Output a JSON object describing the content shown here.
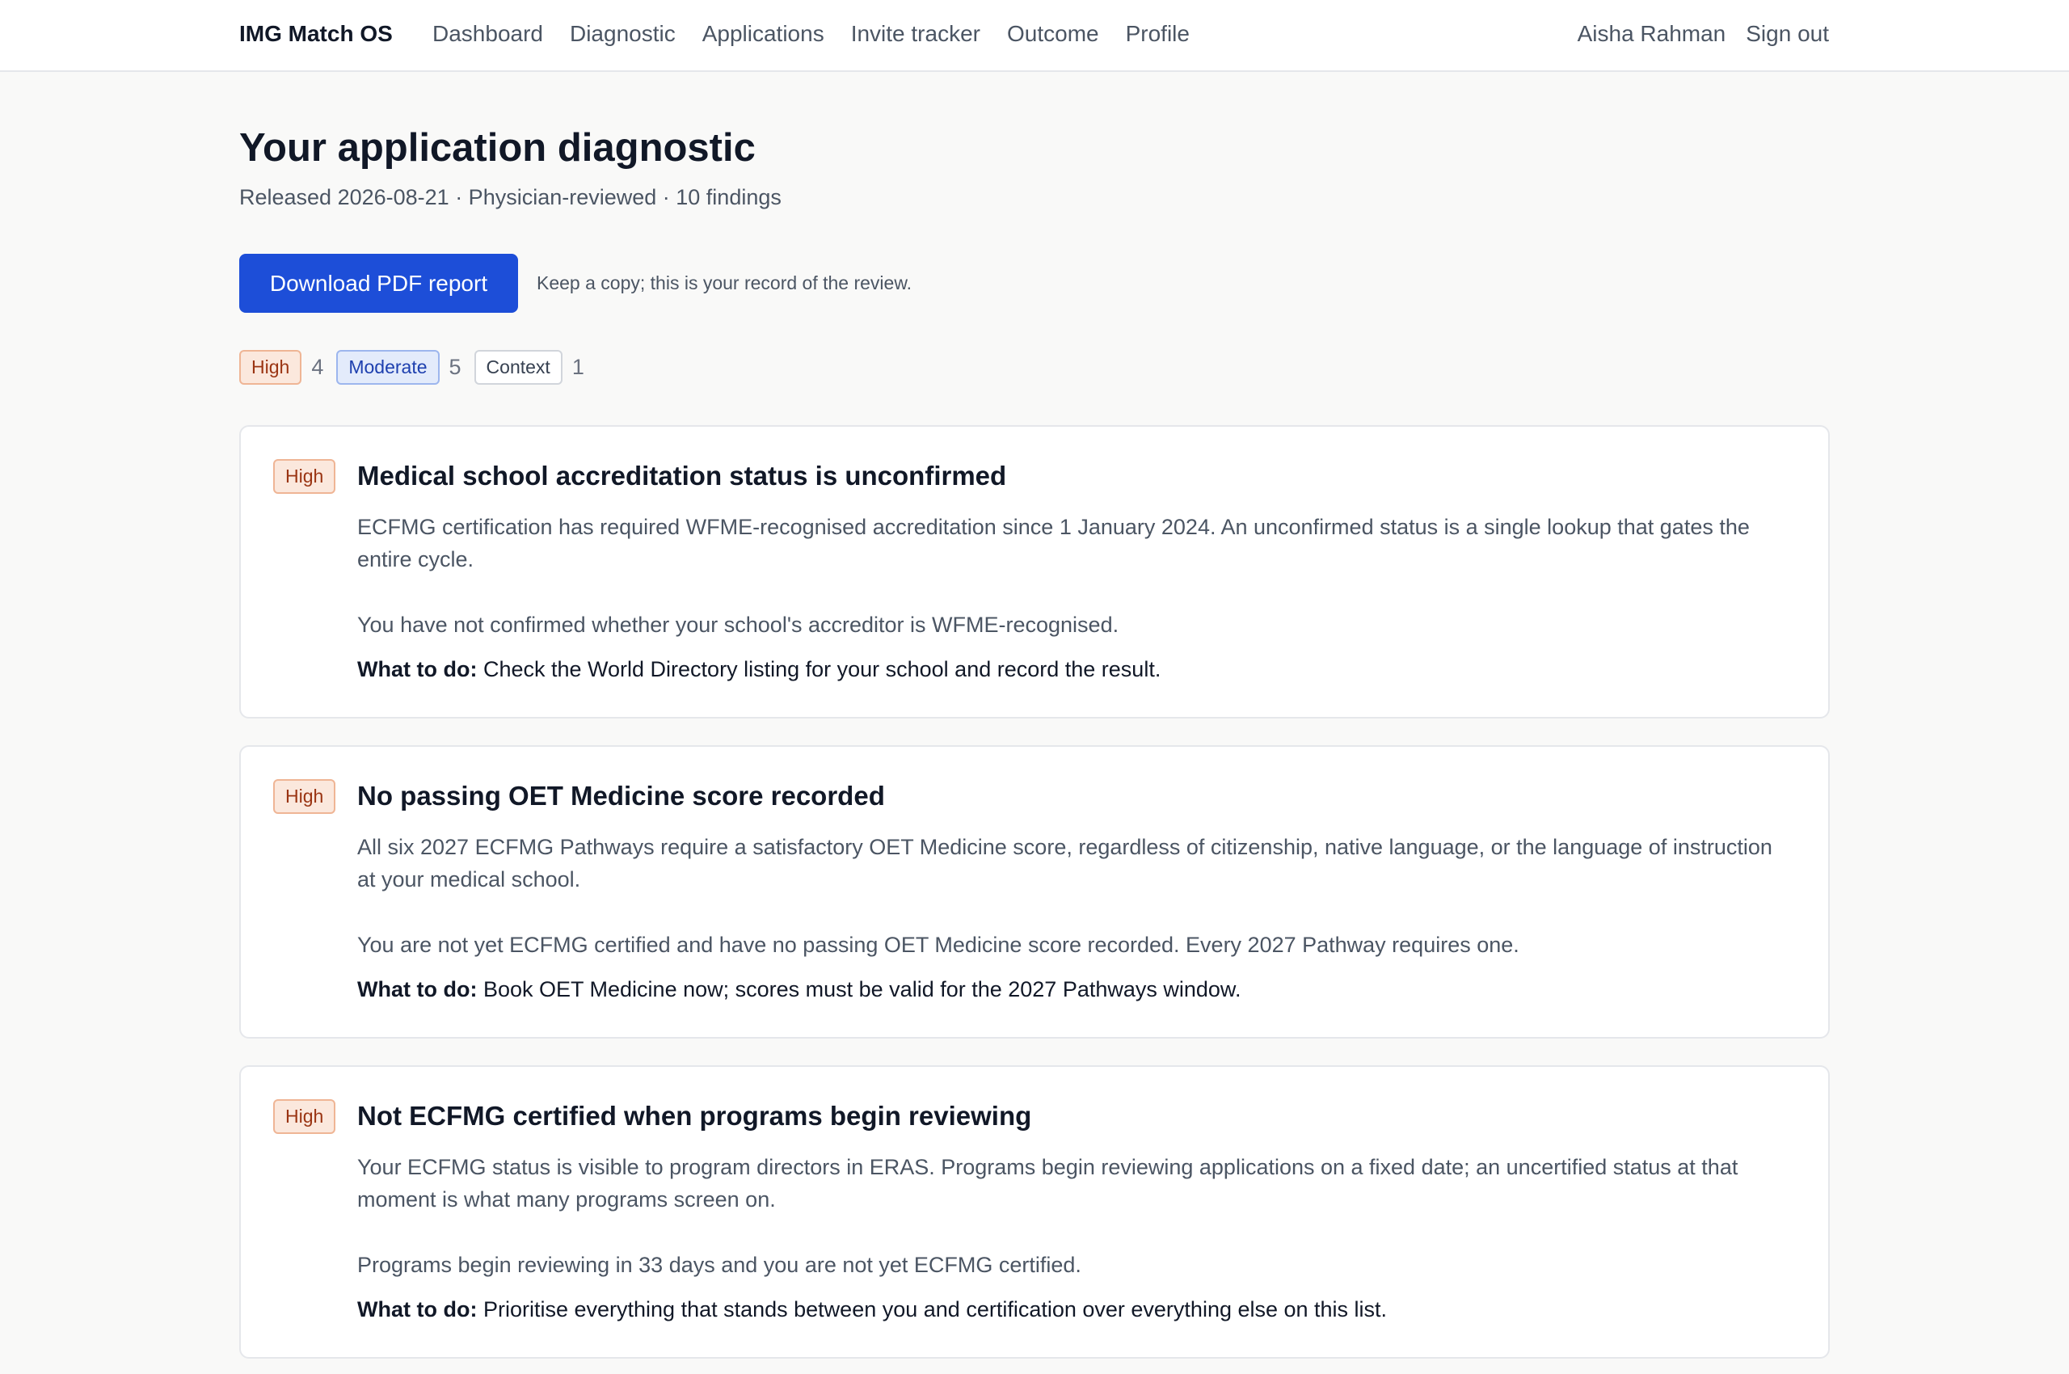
{
  "nav": {
    "brand": "IMG Match OS",
    "links": [
      "Dashboard",
      "Diagnostic",
      "Applications",
      "Invite tracker",
      "Outcome",
      "Profile"
    ],
    "user_name": "Aisha Rahman",
    "sign_out": "Sign out"
  },
  "page": {
    "title": "Your application diagnostic",
    "subtitle": "Released 2026-08-21 · Physician-reviewed · 10 findings",
    "download_label": "Download PDF report",
    "download_note": "Keep a copy; this is your record of the review."
  },
  "summary": {
    "high_label": "High",
    "high_count": "4",
    "moderate_label": "Moderate",
    "moderate_count": "5",
    "context_label": "Context",
    "context_count": "1"
  },
  "findings": [
    {
      "severity": "High",
      "title": "Medical school accreditation status is unconfirmed",
      "description": "ECFMG certification has required WFME-recognised accreditation since 1 January 2024. An unconfirmed status is a single lookup that gates the entire cycle.",
      "detail": "You have not confirmed whether your school's accreditor is WFME-recognised.",
      "action_label": "What to do:",
      "action": "Check the World Directory listing for your school and record the result."
    },
    {
      "severity": "High",
      "title": "No passing OET Medicine score recorded",
      "description": "All six 2027 ECFMG Pathways require a satisfactory OET Medicine score, regardless of citizenship, native language, or the language of instruction at your medical school.",
      "detail": "You are not yet ECFMG certified and have no passing OET Medicine score recorded. Every 2027 Pathway requires one.",
      "action_label": "What to do:",
      "action": "Book OET Medicine now; scores must be valid for the 2027 Pathways window."
    },
    {
      "severity": "High",
      "title": "Not ECFMG certified when programs begin reviewing",
      "description": "Your ECFMG status is visible to program directors in ERAS. Programs begin reviewing applications on a fixed date; an uncertified status at that moment is what many programs screen on.",
      "detail": "Programs begin reviewing in 33 days and you are not yet ECFMG certified.",
      "action_label": "What to do:",
      "action": "Prioritise everything that stands between you and certification over everything else on this list."
    }
  ]
}
